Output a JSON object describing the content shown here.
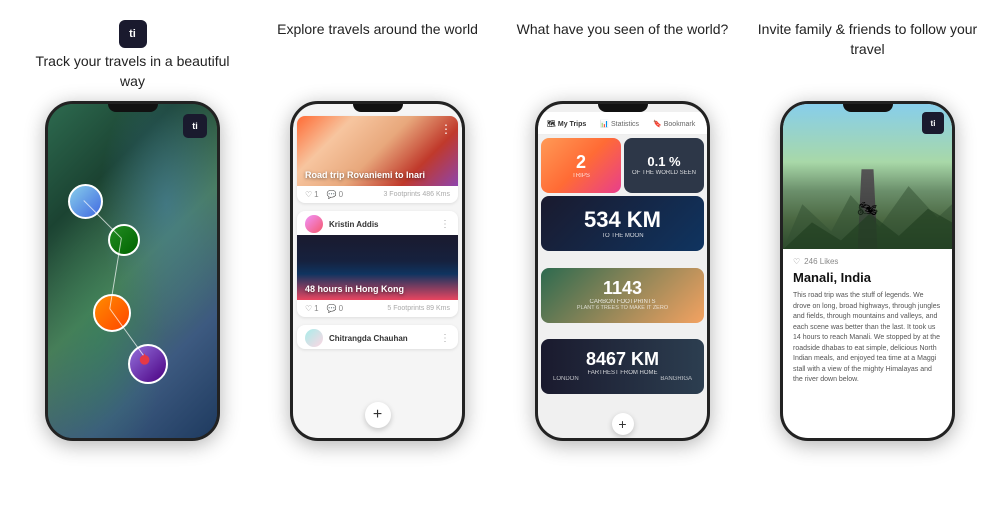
{
  "app": {
    "logo": "ti"
  },
  "features": [
    {
      "id": "track",
      "title": "Track your travels in a beautiful way",
      "show_logo": true
    },
    {
      "id": "explore",
      "title": "Explore travels around the world",
      "show_logo": false
    },
    {
      "id": "seen",
      "title": "What have you seen of the world?",
      "show_logo": false
    },
    {
      "id": "invite",
      "title": "Invite family & friends to follow your travel",
      "show_logo": false
    }
  ],
  "phone1": {
    "type": "map"
  },
  "phone2": {
    "type": "feed",
    "cards": [
      {
        "title": "Road trip Rovaniemi to Inari",
        "likes": "1",
        "comments": "0",
        "meta": "3 Footprints 486 Kms"
      },
      {
        "user": "Kristin Addis",
        "title": "48 hours in Hong Kong",
        "likes": "1",
        "comments": "0",
        "meta": "5 Footprints 89 Kms"
      },
      {
        "user": "Chitrangda Chauhan",
        "title": "",
        "likes": "",
        "comments": "",
        "meta": ""
      }
    ]
  },
  "phone3": {
    "type": "stats",
    "tabs": [
      "My Trips",
      "Statistics",
      "Bookmark"
    ],
    "stats": [
      {
        "number": "2",
        "label": "TRIPS"
      },
      {
        "number": "0.1 %",
        "label": "OF THE WORLD SEEN"
      },
      {
        "number": "534 KM",
        "label": "TO THE MOON"
      },
      {
        "number": "1143",
        "label": "CARBON FOOTPRINTS",
        "sublabel": "PLANT 6 TREES TO MAKE IT ZERO"
      },
      {
        "number": "8467 KM",
        "label": "FARTHEST FROM HOME",
        "from": "LONDON",
        "to": "BANGRIGA"
      }
    ]
  },
  "phone4": {
    "type": "blog",
    "likes": "246 Likes",
    "title": "Manali, India",
    "body": "This road trip was the stuff of legends. We drove on long, broad highways, through jungles and fields, through mountains and valleys, and each scene was better than the last. It took us 14 hours to reach Manali. We stopped by at the roadside dhabas to eat simple, delicious North Indian meals, and enjoyed tea time at a Maggi stall with a view of the mighty Himalayas and the river down below."
  }
}
